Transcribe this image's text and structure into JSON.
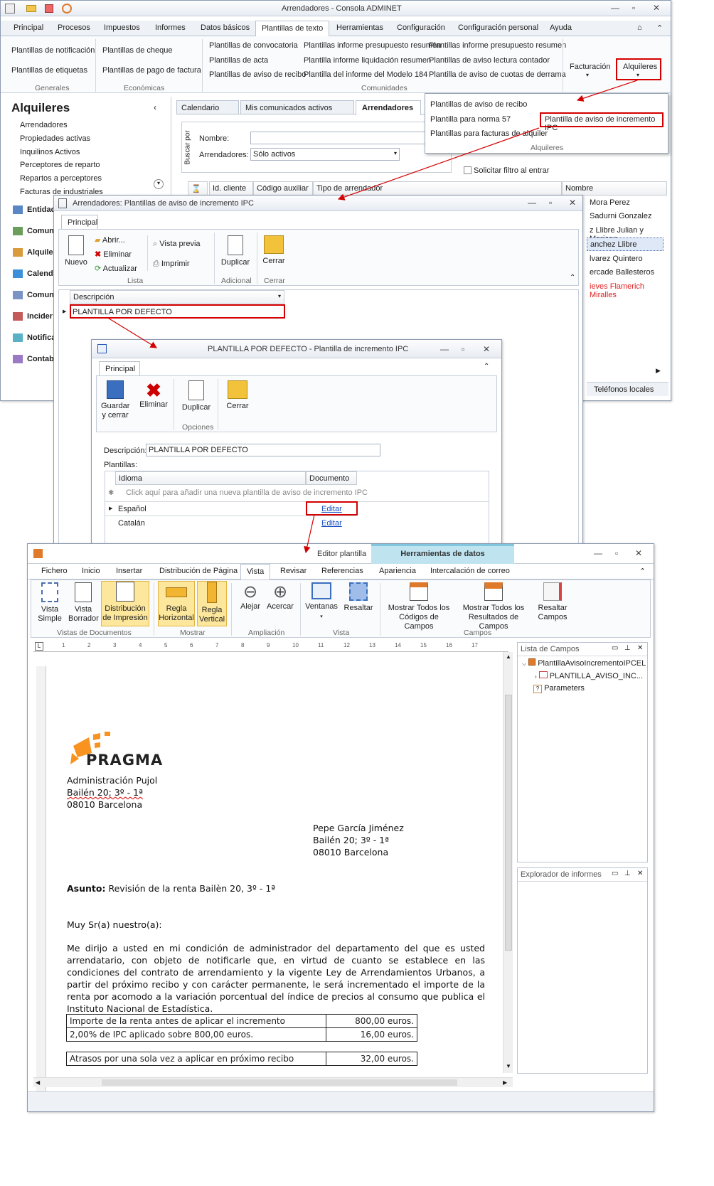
{
  "main": {
    "title": "Arrendadores - Consola ADMINET",
    "tabs": [
      "Principal",
      "Procesos",
      "Impuestos",
      "Informes",
      "Datos básicos",
      "Plantillas de texto",
      "Herramientas",
      "Configuración",
      "Configuración personal",
      "Ayuda"
    ],
    "ribbon": {
      "generales": [
        "Plantillas de notificación",
        "Plantillas de etiquetas"
      ],
      "generales_label": "Generales",
      "economicas": [
        "Plantillas de cheque",
        "Plantillas de pago de factura"
      ],
      "economicas_label": "Económicas",
      "com1": [
        "Plantillas de convocatoria",
        "Plantillas de acta",
        "Plantillas de aviso de recibo"
      ],
      "com2": [
        "Plantillas informe presupuesto resumen",
        "Plantilla informe liquidación resumen",
        "Plantilla del informe del Modelo 184"
      ],
      "com3": [
        "Plantillas informe presupuesto resumen",
        "Plantillas de aviso lectura contador",
        "Plantilla de aviso de cuotas de derrama"
      ],
      "comunidades_label": "Comunidades",
      "facturacion": "Facturación",
      "alquileres": "Alquileres"
    },
    "dropdown": {
      "items": [
        "Plantillas de aviso de recibo",
        "Plantilla para norma 57",
        "Plantillas para facturas de alquiler"
      ],
      "highlight": "Plantilla de aviso de incremento IPC",
      "group": "Alquileres"
    },
    "sidebar": {
      "title": "Alquileres",
      "items": [
        "Arrendadores",
        "Propiedades activas",
        "Inquilinos Activos",
        "Perceptores de reparto",
        "Repartos a perceptores",
        "Facturas de industriales"
      ],
      "nav": [
        "Entidad",
        "Comun",
        "Alquile",
        "Calend",
        "Comun",
        "Incider",
        "Notifica",
        "Contab"
      ]
    },
    "doctabs": [
      "Calendario",
      "Mis comunicados activos",
      "Arrendadores"
    ],
    "search": {
      "vlabel": "Buscar por",
      "nombre": "Nombre:",
      "arrendadores": "Arrendadores:",
      "select": "Sólo activos",
      "solicitar": "Solicitar filtro al entrar"
    },
    "grid": {
      "cols": [
        "Id. cliente",
        "Código auxiliar",
        "Tipo de arrendador",
        "Nombre"
      ],
      "names": [
        "Mora Perez",
        "Sadurni Gonzalez",
        "z Llibre Julian y Mariano",
        "anchez Llibre",
        "lvarez Quintero",
        "ercade Ballesteros",
        "ieves Flamerich Miralles"
      ]
    },
    "status": "Teléfonos locales"
  },
  "win2": {
    "title": "Arrendadores: Plantillas de aviso de incremento IPC",
    "tab": "Principal",
    "btns": {
      "nuevo": "Nuevo",
      "abrir": "Abrir...",
      "eliminar": "Eliminar",
      "actualizar": "Actualizar",
      "vista": "Vista previa",
      "imprimir": "Imprimir",
      "duplicar": "Duplicar",
      "cerrar": "Cerrar"
    },
    "groups": [
      "Lista",
      "Adicional",
      "Cerrar"
    ],
    "col": "Descripción",
    "row": "PLANTILLA POR DEFECTO"
  },
  "win3": {
    "title": "PLANTILLA POR DEFECTO - Plantilla de incremento IPC",
    "tab": "Principal",
    "btns": {
      "guardar": "Guardar y cerrar",
      "eliminar": "Eliminar",
      "duplicar": "Duplicar",
      "cerrar": "Cerrar"
    },
    "group": "Opciones",
    "desc_label": "Descripción:",
    "desc_value": "PLANTILLA POR DEFECTO",
    "plantillas": "Plantillas:",
    "cols": [
      "Idioma",
      "Documento"
    ],
    "newrow": "Click aquí para añadir una nueva plantilla de aviso de incremento IPC",
    "rows": [
      {
        "idioma": "Español",
        "doc": "Editar"
      },
      {
        "idioma": "Catalán",
        "doc": "Editar"
      }
    ]
  },
  "win4": {
    "title": "Editor plantilla",
    "tools": "Herramientas de datos",
    "tabs": [
      "Fichero",
      "Inicio",
      "Insertar",
      "Distribución de Página",
      "Vista",
      "Revisar",
      "Referencias",
      "Apariencia",
      "Intercalación de correo"
    ],
    "btns": {
      "simple": "Vista Simple",
      "borrador": "Vista Borrador",
      "distrib": "Distribución de Impresión",
      "rh": "Regla Horizontal",
      "rv": "Regla Vertical",
      "alejar": "Alejar",
      "acercar": "Acercar",
      "ventanas": "Ventanas",
      "resaltar": "Resaltar",
      "mcod": "Mostrar Todos los Códigos de Campos",
      "mres": "Mostrar Todos los Resultados de Campos",
      "rcampos": "Resaltar Campos"
    },
    "groups": [
      "Vistas de Documentos",
      "Mostrar",
      "Ampliación",
      "Vista",
      "Campos"
    ],
    "ruler": [
      "1",
      "2",
      "3",
      "4",
      "5",
      "6",
      "7",
      "8",
      "9",
      "10",
      "11",
      "12",
      "13",
      "14",
      "15",
      "16",
      "17"
    ],
    "panel1": {
      "title": "Lista de Campos",
      "items": [
        "PlantillaAvisoIncrementoIPCEL",
        "PLANTILLA_AVISO_INC...",
        "Parameters"
      ]
    },
    "panel2": {
      "title": "Explorador de informes"
    },
    "doc": {
      "logo": "PRAGMA",
      "sender": [
        "Administración Pujol",
        "Bailén 20; 3º - 1ª",
        "08010 Barcelona"
      ],
      "recipient": [
        "Pepe García Jiménez",
        "Bailén 20; 3º - 1ª",
        "08010 Barcelona"
      ],
      "asunto_label": "Asunto:",
      "asunto": "Revisión de la renta Bailèn 20, 3º - 1ª",
      "saludo": "Muy Sr(a) nuestro(a):",
      "body": "Me dirijo a usted en mi condición de administrador del departamento del que es usted arrendatario, con objeto de notificarle que, en virtud de cuanto se establece en las condiciones del contrato de arrendamiento y la vigente Ley de Arrendamientos Urbanos, a partir del próximo recibo y con carácter permanente, le será incrementado el importe de la renta por acomodo a la variación porcentual del índice de precios al consumo que publica el Instituto Nacional de Estadística.",
      "t1": [
        [
          "Importe de la renta antes de aplicar el incremento",
          "800,00 euros."
        ],
        [
          "2,00% de IPC aplicado sobre 800,00  euros.",
          "16,00 euros."
        ]
      ],
      "t2": [
        [
          "Atrasos por una sola vez a aplicar en próximo recibo",
          "32,00 euros."
        ]
      ]
    }
  },
  "colors": {
    "highlight": "#d40000",
    "accent": "#f7931e",
    "tools": "#7fc6de"
  }
}
